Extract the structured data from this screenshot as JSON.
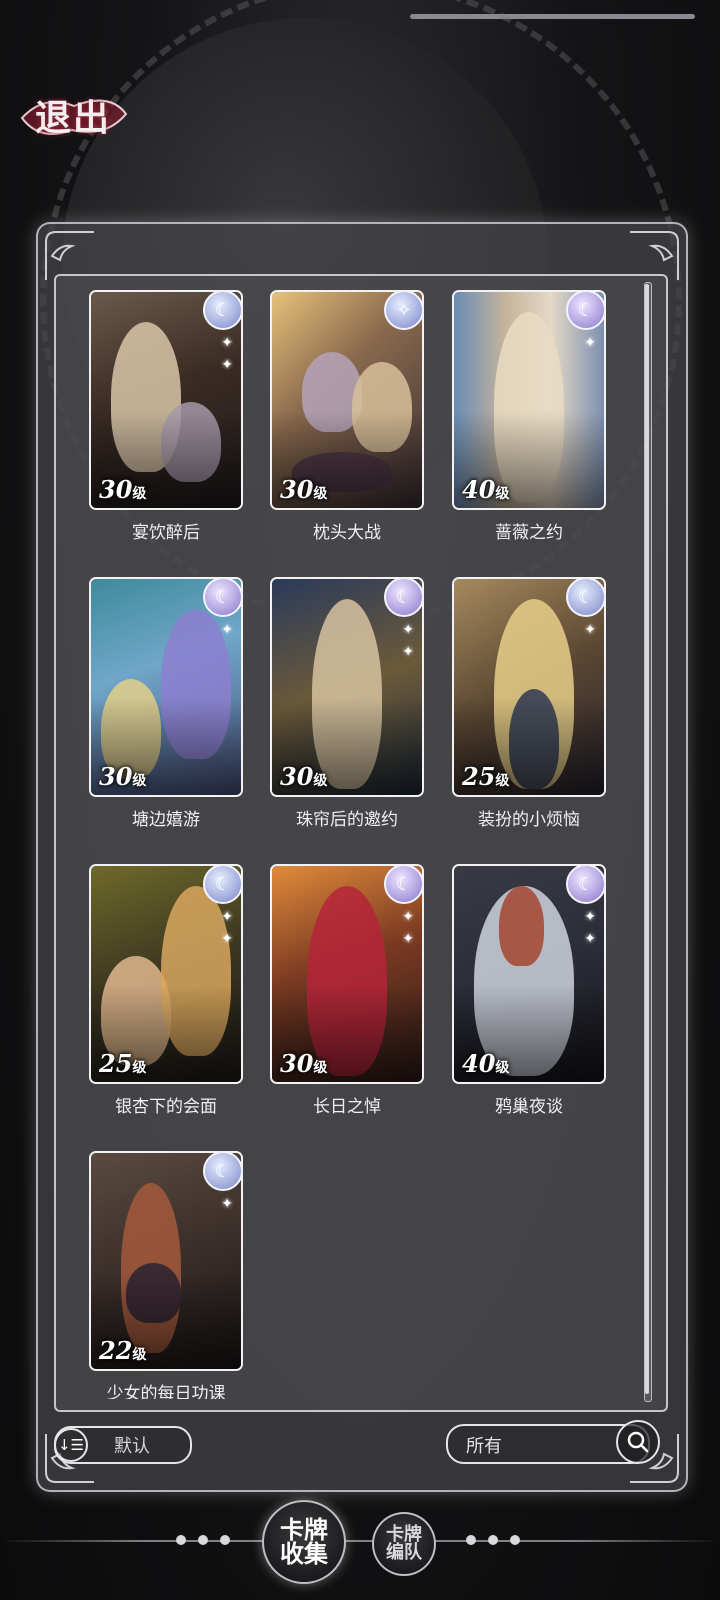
{
  "header": {
    "back_label": "退出"
  },
  "cards": [
    {
      "name": "宴饮醉后",
      "level": "30",
      "level_unit": "级",
      "badge": "blue"
    },
    {
      "name": "枕头大战",
      "level": "30",
      "level_unit": "级",
      "badge": "blue"
    },
    {
      "name": "蔷薇之约",
      "level": "40",
      "level_unit": "级",
      "badge": "violet"
    },
    {
      "name": "塘边嬉游",
      "level": "30",
      "level_unit": "级",
      "badge": "violet"
    },
    {
      "name": "珠帘后的邀约",
      "level": "30",
      "level_unit": "级",
      "badge": "violet"
    },
    {
      "name": "装扮的小烦恼",
      "level": "25",
      "level_unit": "级",
      "badge": "blue"
    },
    {
      "name": "银杏下的会面",
      "level": "25",
      "level_unit": "级",
      "badge": "blue"
    },
    {
      "name": "长日之悼",
      "level": "30",
      "level_unit": "级",
      "badge": "violet"
    },
    {
      "name": "鸦巢夜谈",
      "level": "40",
      "level_unit": "级",
      "badge": "violet"
    },
    {
      "name": "少女的每日功课",
      "level": "22",
      "level_unit": "级",
      "badge": "blue"
    }
  ],
  "controls": {
    "sort_label": "默认",
    "filter_label": "所有"
  },
  "bottom_nav": {
    "collection_label": "卡牌收集",
    "formation_label": "卡牌编队"
  },
  "colors": {
    "panel_border": "#dcdce4",
    "badge_blue": "#9aa6d8",
    "badge_violet": "#a797db"
  }
}
